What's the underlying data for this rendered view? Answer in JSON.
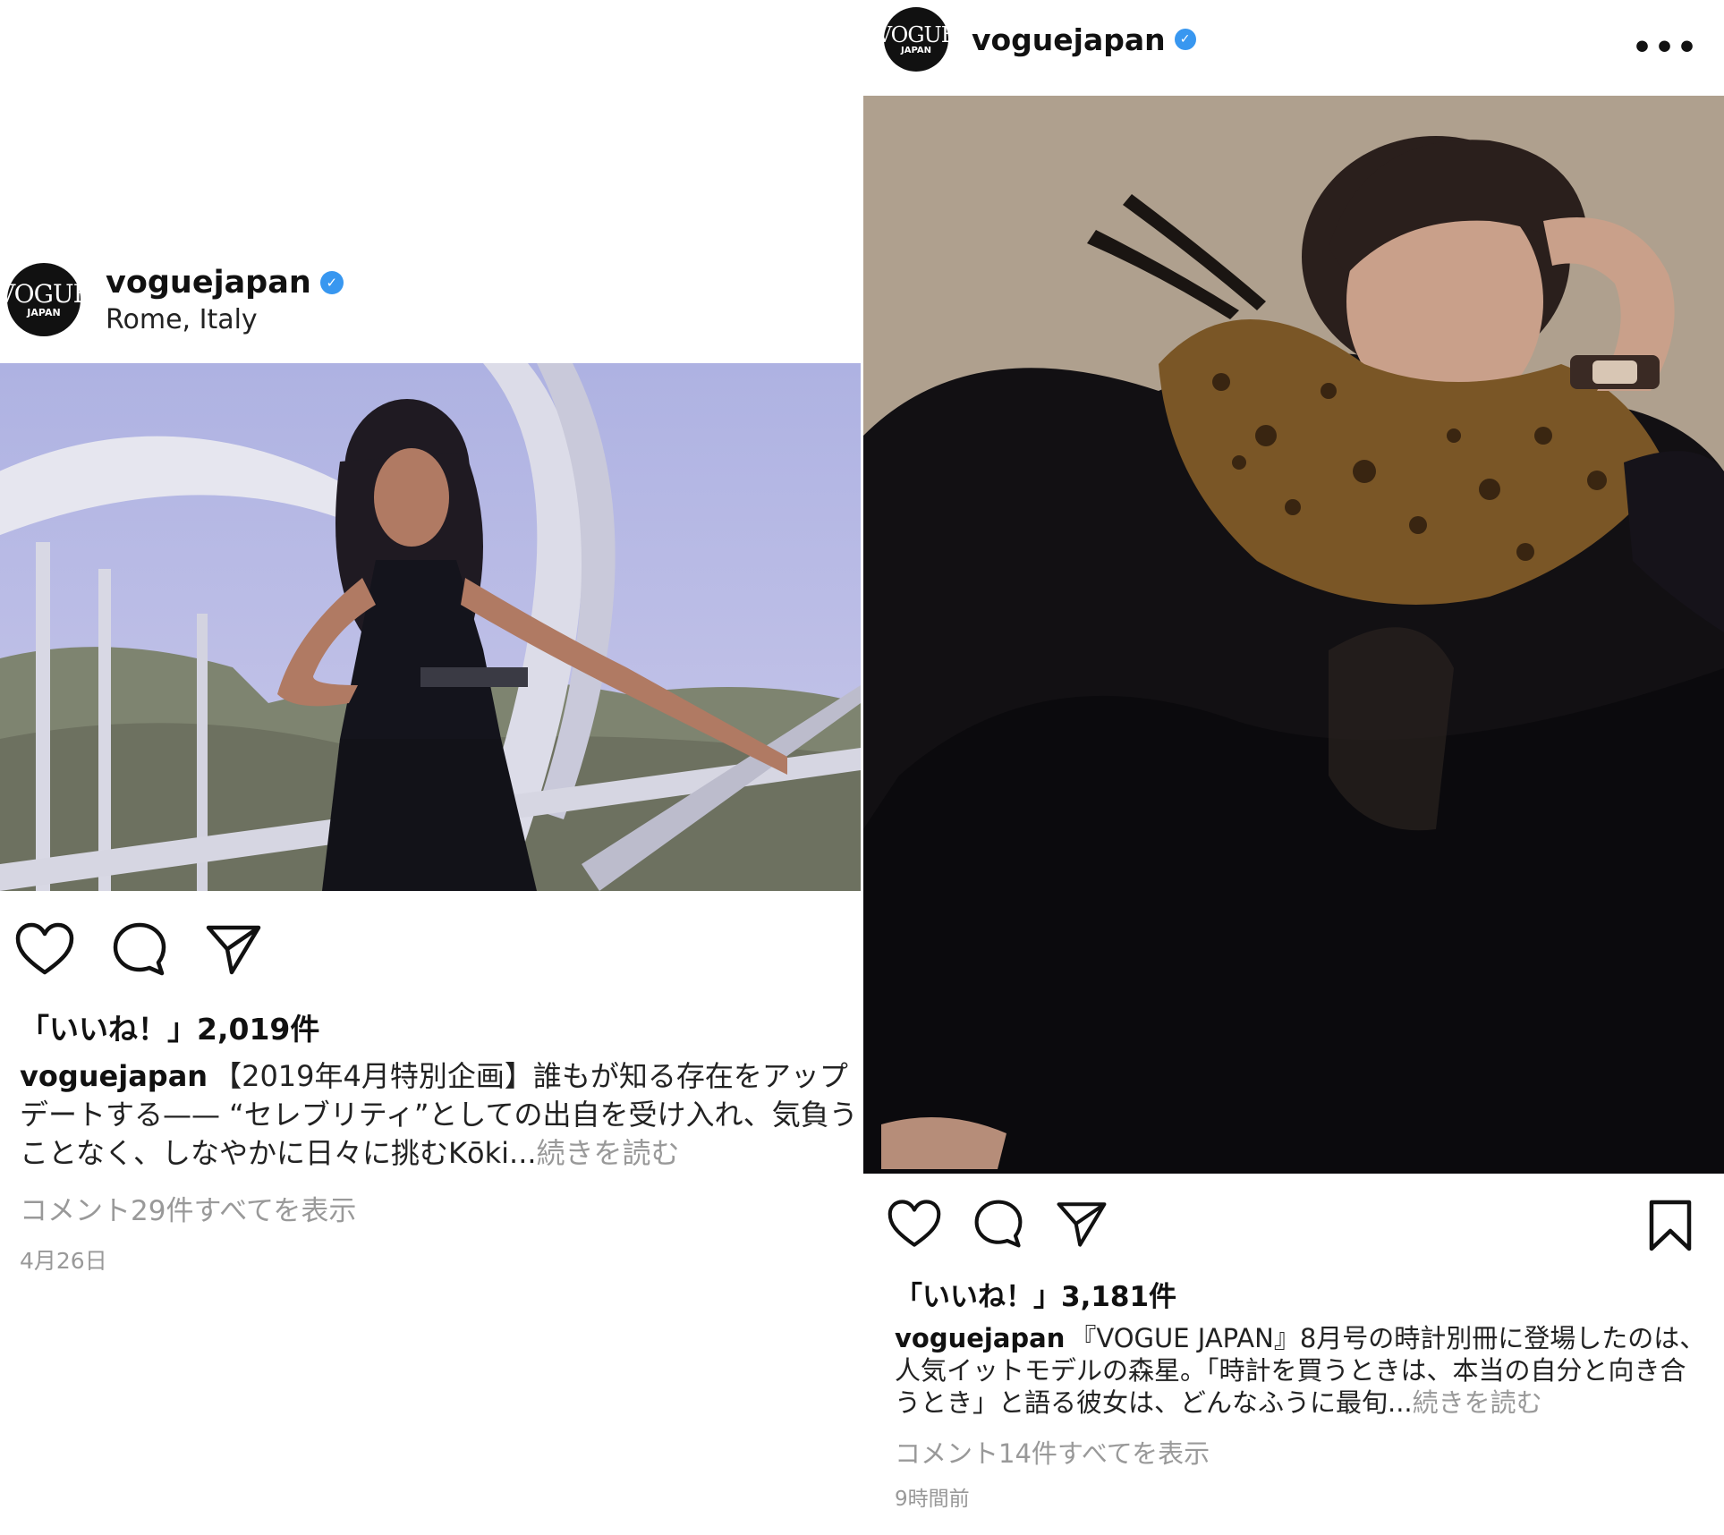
{
  "left_post": {
    "username": "voguejapan",
    "location": "Rome, Italy",
    "avatar_text": {
      "main": "VOGUE",
      "sub": "JAPAN"
    },
    "likes": "「いいね！」2,019件",
    "caption": {
      "username": "voguejapan",
      "text": "【2019年4月特別企画】誰もが知る存在をアップデートする—— “セレブリティ”としての出自を受け入れ、気負うことなく、しなやかに日々に挑むKōki...",
      "more": "続きを読む"
    },
    "comments_link": "コメント29件すべてを表示",
    "timestamp": "4月26日"
  },
  "right_post": {
    "username": "voguejapan",
    "avatar_text": {
      "main": "VOGUE",
      "sub": "JAPAN"
    },
    "likes": "「いいね！」3,181件",
    "caption": {
      "username": "voguejapan",
      "text": "『VOGUE JAPAN』8月号の時計別冊に登場したのは、人気イットモデルの森星。「時計を買うときは、本当の自分と向き合うとき」と語る彼女は、どんなふうに最旬...",
      "more": "続きを読む"
    },
    "comments_link": "コメント14件すべてを表示",
    "timestamp": "9時間前"
  },
  "icons": [
    "heart-icon",
    "comment-icon",
    "share-icon",
    "bookmark-icon",
    "verified-badge-icon",
    "more-options-icon"
  ],
  "colors": {
    "verified": "#3897f0",
    "muted_text": "#999999",
    "avatar_bg": "#111111"
  }
}
